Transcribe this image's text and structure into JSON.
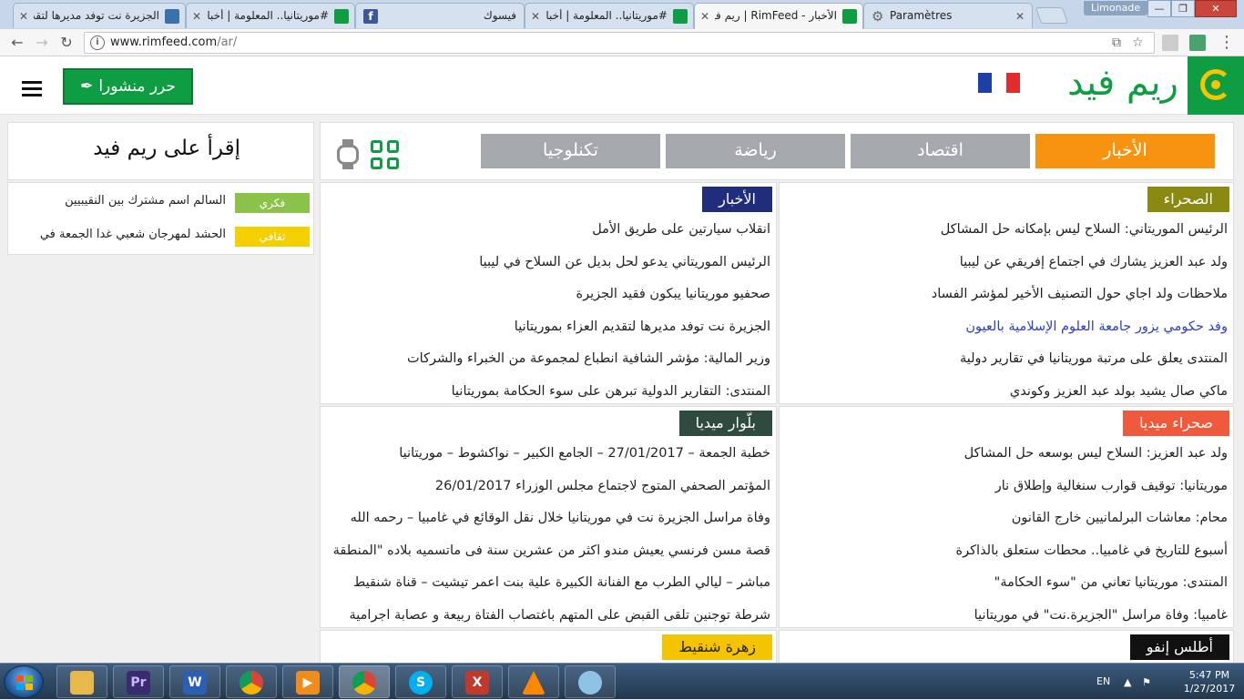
{
  "browser": {
    "tabs": [
      {
        "title": "الجزيرة نت توفد مديرها لتقديم",
        "active": false
      },
      {
        "title": "#موريتانيا.. المعلومة | أخبار #م",
        "active": false
      },
      {
        "title": "فيسوك",
        "active": false
      },
      {
        "title": "#موريتانيا.. المعلومة | أخبار #",
        "active": false
      },
      {
        "title": "الأخبار - RimFeed | ريم فيد",
        "active": true
      },
      {
        "title": "Paramètres",
        "active": false
      }
    ],
    "profile": "Limonade",
    "url_host": "www.rimfeed.com",
    "url_path": "/ar/",
    "minimize": "—",
    "maximize": "❐",
    "close": "✕"
  },
  "header": {
    "logo_text": "ريم فيد",
    "post_button": "حرر منشورا",
    "post_icon": "✒"
  },
  "sidebar": {
    "read_title": "إقرأ على ريم فيد",
    "items": [
      {
        "tag": "فكري",
        "tag_color": "#8bc34a",
        "text": "السالم اسم مشترك بين النقيبيين"
      },
      {
        "tag": "ثقافي",
        "tag_color": "#f4d000",
        "text": "الحشد لمهرجان شعبي غدا الجمعة في"
      }
    ]
  },
  "categories": [
    {
      "label": "الأخبار",
      "active": true
    },
    {
      "label": "اقتصاد",
      "active": false
    },
    {
      "label": "رياضة",
      "active": false
    },
    {
      "label": "تكنلوجيا",
      "active": false
    }
  ],
  "panels": {
    "sahra": {
      "title": "الصحراء",
      "color": "#8a8a12",
      "items": [
        "الرئيس الموريتاني: السلاح ليس بإمكانه حل المشاكل",
        "ولد عبد العزيز يشارك في اجتماع إفريقي عن ليبيا",
        "ملاحظات ولد اجاي حول التصنيف الأخير لمؤشر الفساد",
        "وفد حكومي يزور جامعة العلوم الإسلامية بالعيون",
        "المنتدى يعلق على مرتبة موريتانيا في تقارير دولية",
        "ماكي صال يشيد بولد عبد العزيز وكوندي"
      ]
    },
    "akhbar": {
      "title": "الأخبار",
      "color": "#1f2d7a",
      "items": [
        "انقلاب سيارتين على طريق الأمل",
        "الرئيس الموريتاني يدعو لحل بديل عن السلاح في ليبيا",
        "صحفيو موريتانيا يبكون فقيد الجزيرة",
        "الجزيرة نت توفد مديرها لتقديم العزاء بموريتانيا",
        "وزير المالية: مؤشر الشافية انطباع لمجموعة من الخبراء والشركات",
        "المنتدى: التقارير الدولية تبرهن على سوء الحكامة بموريتانيا"
      ]
    },
    "sahra_media": {
      "title": "صحراء ميديا",
      "color": "#f05a3c",
      "items": [
        "ولد عبد العزيز: السلاح ليس بوسعه حل المشاكل",
        "موريتانيا: توقيف قوارب سنغالية وإطلاق نار",
        "محام: معاشات البرلمانيين خارج القانون",
        "أسبوع للتاريخ في غامبيا.. محطات ستعلق بالذاكرة",
        "المنتدى: موريتانيا تعاني من \"سوء الحكامة\"",
        "غامبيا: وفاة مراسل \"الجزيرة.نت\" في موريتانيا"
      ]
    },
    "bellewar": {
      "title": "بلّوار ميديا",
      "color": "#2f4a3e",
      "items": [
        "خطبة الجمعة – 27/01/2017 – الجامع الكبير – نواكشوط – موريتانيا",
        "المؤتمر الصحفي المتوج لاجتماع مجلس الوزراء 26/01/2017",
        "وفاة مراسل الجزيرة نت في موريتانيا خلال نقل الوقائع في غامبيا – رحمه الله",
        "قصة مسن فرنسي يعيش مندو اكثر من عشرين سنة فى ماتسميه بلاده \"المنطقة",
        "مباشر – ليالي الطرب مع الفنانة الكبيرة علية بنت اعمر تيشيت – قناة شنقيط",
        "شرطة توجنين تلقى القبض على المتهم باغتصاب الفتاة ربيعة و عصابة اجرامية"
      ]
    },
    "atlas": {
      "title": "أطلس إنفو",
      "color": "#111111",
      "items": []
    },
    "zahra": {
      "title": "زهرة شنقيط",
      "color": "#f4c400",
      "items": []
    }
  },
  "taskbar": {
    "apps": [
      "folder",
      "Pr",
      "W",
      "chrome",
      "media",
      "chrome-active",
      "skype",
      "X",
      "vlc",
      "paint"
    ],
    "lang": "EN",
    "time": "5:47 PM",
    "date": "1/27/2017"
  }
}
